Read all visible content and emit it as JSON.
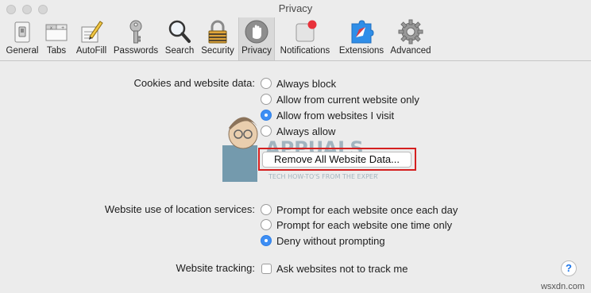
{
  "window": {
    "title": "Privacy"
  },
  "toolbar": {
    "items": [
      {
        "label": "General",
        "icon": "general-icon"
      },
      {
        "label": "Tabs",
        "icon": "tabs-icon"
      },
      {
        "label": "AutoFill",
        "icon": "autofill-icon"
      },
      {
        "label": "Passwords",
        "icon": "key-icon"
      },
      {
        "label": "Search",
        "icon": "search-icon"
      },
      {
        "label": "Security",
        "icon": "lock-icon"
      },
      {
        "label": "Privacy",
        "icon": "hand-icon",
        "selected": true
      },
      {
        "label": "Notifications",
        "icon": "notifications-icon"
      },
      {
        "label": "Extensions",
        "icon": "extensions-icon"
      },
      {
        "label": "Advanced",
        "icon": "gear-icon"
      }
    ]
  },
  "cookies": {
    "label": "Cookies and website data:",
    "options": [
      "Always block",
      "Allow from current website only",
      "Allow from websites I visit",
      "Always allow"
    ],
    "selected_option": "Allow from websites I visit",
    "remove_button": "Remove All Website Data..."
  },
  "location": {
    "label": "Website use of location services:",
    "options": [
      "Prompt for each website once each day",
      "Prompt for each website one time only",
      "Deny without prompting"
    ],
    "selected_option": "Deny without prompting"
  },
  "tracking": {
    "label": "Website tracking:",
    "option": "Ask websites not to track me",
    "checked": false
  },
  "help": "?",
  "watermark": {
    "brand": "APPUALS",
    "tagline": "TECH HOW-TO'S FROM THE EXPERTS"
  },
  "corner_text": "wsxdn.com"
}
